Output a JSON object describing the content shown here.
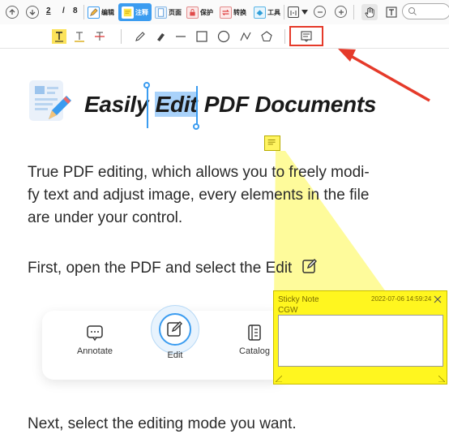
{
  "toolbar": {
    "page_current": "2",
    "page_separator": "/",
    "page_total": "8",
    "tabs": [
      {
        "label": "编辑",
        "icon": "edit-icon"
      },
      {
        "label": "注释",
        "icon": "annotate-icon"
      },
      {
        "label": "页面",
        "icon": "page-icon"
      },
      {
        "label": "保护",
        "icon": "protect-icon"
      },
      {
        "label": "转换",
        "icon": "convert-icon"
      },
      {
        "label": "工具",
        "icon": "tools-icon"
      }
    ],
    "active_tab": "注释",
    "accent": "#3b9cf0"
  },
  "annotation_tools": [
    "highlight-icon",
    "underline-icon",
    "strikethrough-icon",
    "pencil-icon",
    "eraser-icon",
    "line-icon",
    "rectangle-icon",
    "circle-icon",
    "polyline-icon",
    "polygon-icon",
    "sticky-note-icon"
  ],
  "document": {
    "headline_before": "Easily ",
    "headline_selected": "Edit",
    "headline_after": " PDF Documents",
    "paragraph1": [
      "True PDF editing, which allows you to freely modi-",
      "fy text and adjust image, every elements in the file",
      "are under your control."
    ],
    "step1": "First, open the PDF and select the Edit",
    "card": {
      "buttons": [
        {
          "label": "Annotate",
          "icon": "annotate-icon"
        },
        {
          "label": "Edit",
          "icon": "edit-icon"
        },
        {
          "label": "Catalog",
          "icon": "catalog-icon"
        }
      ]
    },
    "step2": "Next, select the editing mode you want."
  },
  "sticky_note": {
    "title": "Sticky Note",
    "author": "CGW",
    "timestamp": "2022-07-06 14:59:24",
    "content": "",
    "color": "#fff61f"
  },
  "highlight_color": "#e53a2a"
}
